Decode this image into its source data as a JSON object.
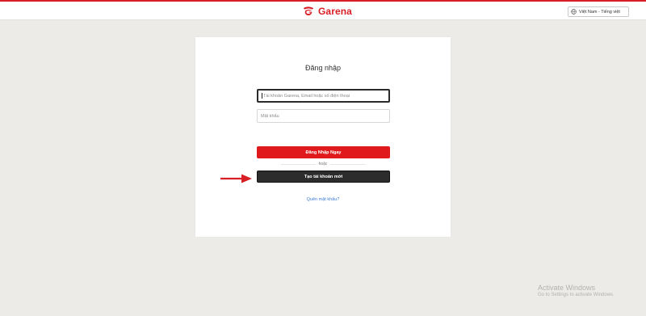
{
  "header": {
    "brand": "Garena",
    "language": "Việt Nam - Tiếng việt",
    "accent_color": "#d81f26"
  },
  "login": {
    "title": "Đăng nhập",
    "account_placeholder": "Tài khoản Garena, Email hoặc số điện thoại",
    "password_placeholder": "Mật khẩu",
    "login_button": "Đăng Nhập Ngay",
    "or_text": "hoặc",
    "create_button": "Tạo tài khoản mới",
    "forgot_link": "Quên mật khẩu?"
  },
  "watermark": {
    "title": "Activate Windows",
    "subtitle": "Go to Settings to activate Windows."
  },
  "icons": {
    "logo": "garena-logo-icon",
    "language": "globe-icon",
    "annotation": "red-arrow-icon"
  }
}
